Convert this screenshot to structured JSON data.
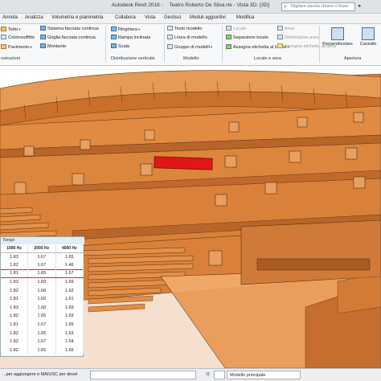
{
  "window": {
    "app_name": "Autodesk Revit 2018 -",
    "project_title": "Teatro Roberto De Silva.rte - Vista 3D: {3D}",
    "search_placeholder": "Digitare parola chiave o frase",
    "help_icon": "question-icon"
  },
  "menu_tabs": [
    "Annota",
    "Analizza",
    "Volumetria e planimetria",
    "Collabora",
    "Vista",
    "Gestisci",
    "Moduli aggiuntivi",
    "Modifica"
  ],
  "ribbon": {
    "col1": [
      "Tetto",
      "Controsoffitto",
      "Pavimento"
    ],
    "col2": [
      "Sistema facciata continua",
      "Griglia facciata continua",
      "Montante"
    ],
    "col3": [
      "Ringhiera",
      "Rampa inclinata",
      "Scala"
    ],
    "col4": [
      "Testo modello",
      "Linea di modello",
      "Gruppo di modelli"
    ],
    "col5": [
      "Locale",
      "Separatore locale",
      "Assegna etichetta al locale"
    ],
    "col6": [
      "Area",
      "Delimitatore area",
      "Assegna etichetta all'area"
    ],
    "panels": {
      "p1": "ostruzioni",
      "p2": "Distribuzione verticale",
      "p3": "Modello",
      "p4": "Locale e area",
      "p5": "Apertura"
    },
    "big_buttons": [
      "Perpendicolare",
      "Cavedio"
    ]
  },
  "acoustic_table": {
    "title": "Tempi",
    "headers": [
      "1000 Hz",
      "2000 Hz",
      "4000 Hz"
    ],
    "rows": [
      [
        "1.83",
        "1.67",
        "1.65"
      ],
      [
        "1.82",
        "1.67",
        "1.46"
      ],
      [
        "1.81",
        "1.65",
        "1.67"
      ],
      [
        "1.83",
        "1.69",
        "1.69"
      ],
      [
        "1.82",
        "1.68",
        "1.62"
      ],
      [
        "1.81",
        "1.69",
        "1.61"
      ],
      [
        "1.83",
        "1.68",
        "1.69"
      ],
      [
        "1.82",
        "1.65",
        "1.69"
      ],
      [
        "1.81",
        "1.67",
        "1.65"
      ],
      [
        "1.82",
        "1.65",
        "1.63"
      ],
      [
        "1.82",
        "1.67",
        "1.64"
      ],
      [
        "1.82",
        "1.65",
        "1.65"
      ]
    ],
    "highlighted_row": 2
  },
  "status": {
    "hint": "...per aggiungere e MAIUSC per desel",
    "zero": ":0",
    "model_dropdown": "Modello principale"
  },
  "colors": {
    "wood": "#d9813a",
    "wood_light": "#e59a55",
    "wood_dark": "#9a5520",
    "highlight": "#e21616",
    "table_highlight": "#d23"
  }
}
